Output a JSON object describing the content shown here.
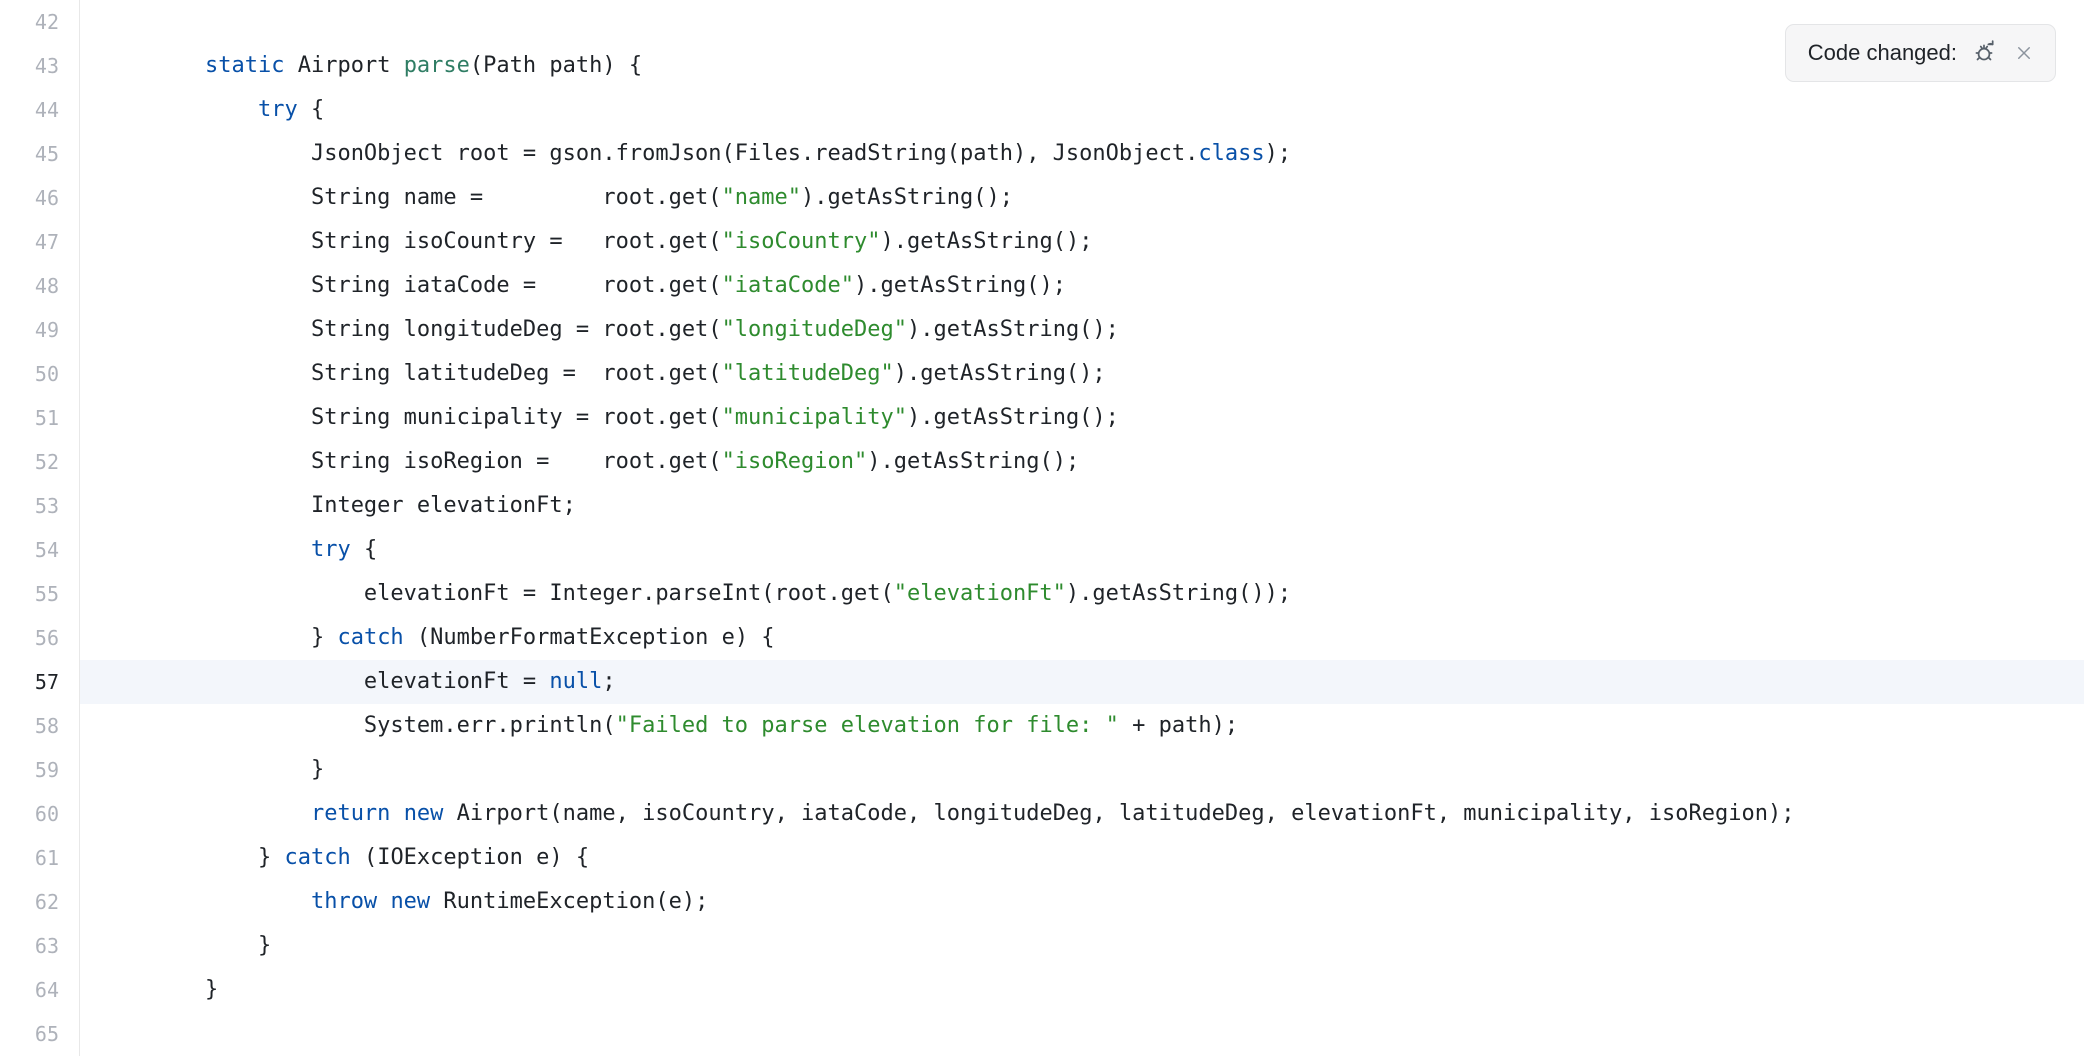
{
  "gutter": {
    "start": 42,
    "end": 65,
    "active": 57
  },
  "notification": {
    "text": "Code changed:",
    "icon": "bug-refresh-icon",
    "close": "close-icon"
  },
  "code": {
    "lang": "java",
    "highlight_line": 57,
    "lines": [
      {
        "n": 42,
        "indent": 0,
        "tokens": []
      },
      {
        "n": 43,
        "indent": 1,
        "tokens": [
          {
            "t": "kw",
            "v": "static"
          },
          {
            "t": "sp",
            "v": " "
          },
          {
            "t": "type",
            "v": "Airport"
          },
          {
            "t": "sp",
            "v": " "
          },
          {
            "t": "fn",
            "v": "parse"
          },
          {
            "t": "",
            "v": "(Path path) {"
          }
        ]
      },
      {
        "n": 44,
        "indent": 2,
        "tokens": [
          {
            "t": "kw",
            "v": "try"
          },
          {
            "t": "",
            "v": " {"
          }
        ]
      },
      {
        "n": 45,
        "indent": 3,
        "tokens": [
          {
            "t": "",
            "v": "JsonObject root = gson.fromJson(Files.readString(path), JsonObject."
          },
          {
            "t": "cls",
            "v": "class"
          },
          {
            "t": "",
            "v": ");"
          }
        ]
      },
      {
        "n": 46,
        "indent": 3,
        "tokens": [
          {
            "t": "",
            "v": "String name =         root.get("
          },
          {
            "t": "str",
            "v": "\"name\""
          },
          {
            "t": "",
            "v": ").getAsString();"
          }
        ]
      },
      {
        "n": 47,
        "indent": 3,
        "tokens": [
          {
            "t": "",
            "v": "String isoCountry =   root.get("
          },
          {
            "t": "str",
            "v": "\"isoCountry\""
          },
          {
            "t": "",
            "v": ").getAsString();"
          }
        ]
      },
      {
        "n": 48,
        "indent": 3,
        "tokens": [
          {
            "t": "",
            "v": "String iataCode =     root.get("
          },
          {
            "t": "str",
            "v": "\"iataCode\""
          },
          {
            "t": "",
            "v": ").getAsString();"
          }
        ]
      },
      {
        "n": 49,
        "indent": 3,
        "tokens": [
          {
            "t": "",
            "v": "String longitudeDeg = root.get("
          },
          {
            "t": "str",
            "v": "\"longitudeDeg\""
          },
          {
            "t": "",
            "v": ").getAsString();"
          }
        ]
      },
      {
        "n": 50,
        "indent": 3,
        "tokens": [
          {
            "t": "",
            "v": "String latitudeDeg =  root.get("
          },
          {
            "t": "str",
            "v": "\"latitudeDeg\""
          },
          {
            "t": "",
            "v": ").getAsString();"
          }
        ]
      },
      {
        "n": 51,
        "indent": 3,
        "tokens": [
          {
            "t": "",
            "v": "String municipality = root.get("
          },
          {
            "t": "str",
            "v": "\"municipality\""
          },
          {
            "t": "",
            "v": ").getAsString();"
          }
        ]
      },
      {
        "n": 52,
        "indent": 3,
        "tokens": [
          {
            "t": "",
            "v": "String isoRegion =    root.get("
          },
          {
            "t": "str",
            "v": "\"isoRegion\""
          },
          {
            "t": "",
            "v": ").getAsString();"
          }
        ]
      },
      {
        "n": 53,
        "indent": 3,
        "tokens": [
          {
            "t": "",
            "v": "Integer elevationFt;"
          }
        ]
      },
      {
        "n": 54,
        "indent": 3,
        "tokens": [
          {
            "t": "kw",
            "v": "try"
          },
          {
            "t": "",
            "v": " {"
          }
        ]
      },
      {
        "n": 55,
        "indent": 4,
        "tokens": [
          {
            "t": "",
            "v": "elevationFt = Integer.parseInt(root.get("
          },
          {
            "t": "str",
            "v": "\"elevationFt\""
          },
          {
            "t": "",
            "v": ").getAsString());"
          }
        ]
      },
      {
        "n": 56,
        "indent": 3,
        "tokens": [
          {
            "t": "",
            "v": "} "
          },
          {
            "t": "kw",
            "v": "catch"
          },
          {
            "t": "",
            "v": " (NumberFormatException e) {"
          }
        ]
      },
      {
        "n": 57,
        "indent": 4,
        "tokens": [
          {
            "t": "",
            "v": "elevationFt = "
          },
          {
            "t": "kw",
            "v": "null"
          },
          {
            "t": "",
            "v": ";"
          }
        ]
      },
      {
        "n": 58,
        "indent": 4,
        "tokens": [
          {
            "t": "",
            "v": "System.err.println("
          },
          {
            "t": "str",
            "v": "\"Failed to parse elevation for file: \""
          },
          {
            "t": "",
            "v": " + path);"
          }
        ]
      },
      {
        "n": 59,
        "indent": 3,
        "tokens": [
          {
            "t": "",
            "v": "}"
          }
        ]
      },
      {
        "n": 60,
        "indent": 3,
        "tokens": [
          {
            "t": "kw",
            "v": "return"
          },
          {
            "t": "",
            "v": " "
          },
          {
            "t": "kw",
            "v": "new"
          },
          {
            "t": "",
            "v": " Airport(name, isoCountry, iataCode, longitudeDeg, latitudeDeg, elevationFt, municipality, isoRegion);"
          }
        ]
      },
      {
        "n": 61,
        "indent": 2,
        "tokens": [
          {
            "t": "",
            "v": "} "
          },
          {
            "t": "kw",
            "v": "catch"
          },
          {
            "t": "",
            "v": " (IOException e) {"
          }
        ]
      },
      {
        "n": 62,
        "indent": 3,
        "tokens": [
          {
            "t": "kw",
            "v": "throw"
          },
          {
            "t": "",
            "v": " "
          },
          {
            "t": "kw",
            "v": "new"
          },
          {
            "t": "",
            "v": " RuntimeException(e);"
          }
        ]
      },
      {
        "n": 63,
        "indent": 2,
        "tokens": [
          {
            "t": "",
            "v": "}"
          }
        ]
      },
      {
        "n": 64,
        "indent": 1,
        "tokens": [
          {
            "t": "",
            "v": "}"
          }
        ]
      },
      {
        "n": 65,
        "indent": 0,
        "tokens": []
      }
    ]
  }
}
